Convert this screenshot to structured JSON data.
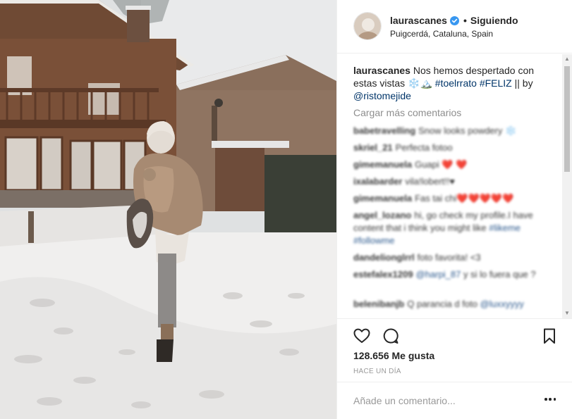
{
  "header": {
    "username": "laurascanes",
    "follow_status": "Siguiendo",
    "separator": "•",
    "location": "Puigcerdá, Cataluna, Spain"
  },
  "caption": {
    "username": "laurascanes",
    "text": "Nos hemos despertado con estas vistas ❄️🏔️ ",
    "hashtag1": "#toelrrato",
    "hashtag2": "#FELIZ",
    "separator": " || by ",
    "mention": "@ristomejide"
  },
  "load_more_label": "Cargar más comentarios",
  "comments": [
    {
      "user": "babetravelling",
      "text": "Snow looks powdery ❄️"
    },
    {
      "user": "skriel_21",
      "text": "Perfecta fotoo"
    },
    {
      "user": "gimemanuela",
      "text": "Guapi ❤️ ❤️"
    },
    {
      "user": "ixalabarder",
      "text": "vila!lobert!!♥"
    },
    {
      "user": "gimemanuela",
      "text": "Fas tai chi❤️❤️❤️❤️❤️"
    },
    {
      "user": "angel_lozano",
      "text": "hi, go check my profile.I have content that i think you might like ",
      "tags": "#likeme #followme"
    },
    {
      "user": "dandelionglrrl",
      "text": "foto favorita! <3"
    },
    {
      "user": "estefalex1209",
      "text": "y si lo fuera que ?",
      "mention": "@harpi_87"
    },
    {
      "user": "belenibanjb",
      "text": "Q parancia d foto ",
      "mention": "@luxxyyyy"
    }
  ],
  "actions": {
    "like_icon": "heart-icon",
    "comment_icon": "comment-bubble-icon",
    "save_icon": "bookmark-icon"
  },
  "likes_text": "128.656 Me gusta",
  "timestamp": "Hace un día",
  "add_comment": {
    "placeholder": "Añade un comentario..."
  },
  "colors": {
    "text": "#262626",
    "link": "#003569",
    "muted": "#999999",
    "border": "#efefef",
    "verified": "#3897f0"
  }
}
